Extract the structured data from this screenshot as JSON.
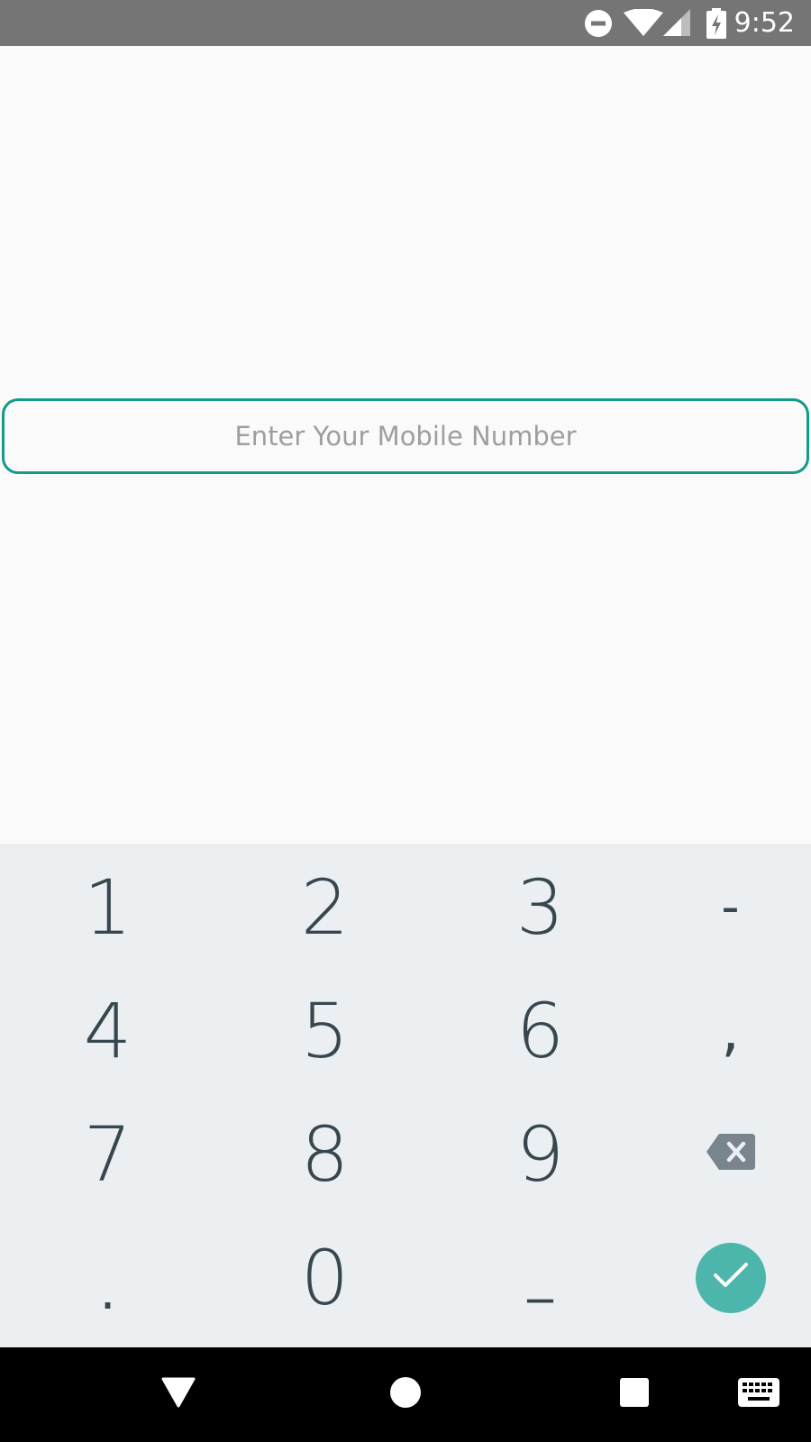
{
  "status_bar": {
    "time": "9:52",
    "icons": [
      "do-not-disturb-icon",
      "wifi-icon",
      "cell-signal-icon",
      "battery-charging-icon"
    ],
    "background": "#757575"
  },
  "phone_input": {
    "placeholder": "Enter Your Mobile Number",
    "value": "",
    "border_color": "#14998a"
  },
  "keypad": {
    "keys": [
      [
        "1",
        "2",
        "3",
        "-"
      ],
      [
        "4",
        "5",
        "6",
        ","
      ],
      [
        "7",
        "8",
        "9",
        "backspace"
      ],
      [
        ".",
        "0",
        "_",
        "done"
      ]
    ],
    "background": "#eceff1",
    "text_color": "#37474f",
    "done_color": "#4db6ac"
  },
  "nav_bar": {
    "buttons": [
      "back-icon",
      "home-icon",
      "recents-icon",
      "keyboard-switch-icon"
    ]
  }
}
